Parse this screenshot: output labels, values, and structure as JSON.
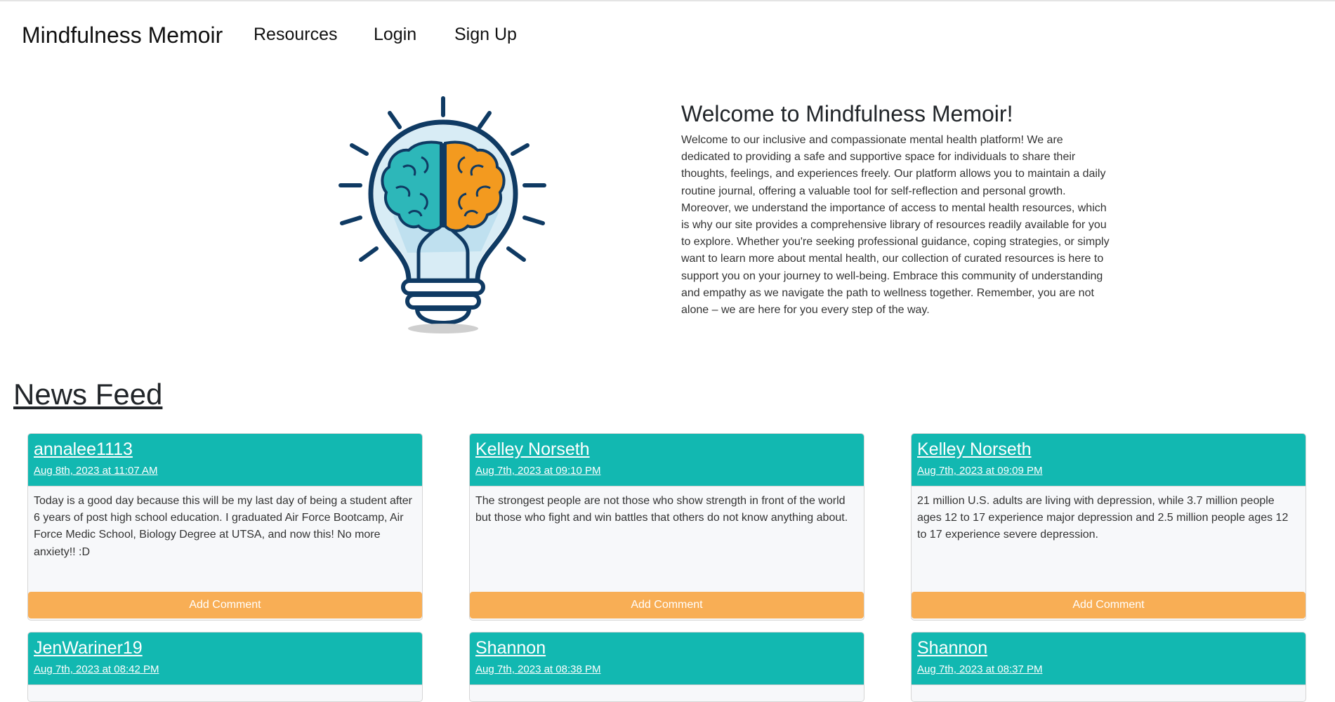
{
  "nav": {
    "brand": "Mindfulness Memoir",
    "links": [
      "Resources",
      "Login",
      "Sign Up"
    ]
  },
  "hero": {
    "title": "Welcome to Mindfulness Memoir!",
    "body": "Welcome to our inclusive and compassionate mental health platform! We are dedicated to providing a safe and supportive space for individuals to share their thoughts, feelings, and experiences freely. Our platform allows you to maintain a daily routine journal, offering a valuable tool for self-reflection and personal growth. Moreover, we understand the importance of access to mental health resources, which is why our site provides a comprehensive library of resources readily available for you to explore. Whether you're seeking professional guidance, coping strategies, or simply want to learn more about mental health, our collection of curated resources is here to support you on your journey to well-being. Embrace this community of understanding and empathy as we navigate the path to wellness together. Remember, you are not alone – we are here for you every step of the way.",
    "image_icon": "lightbulb-brain-icon"
  },
  "feed": {
    "title": "News Feed",
    "button_label": "Add Comment",
    "posts": [
      {
        "user": "annalee1113",
        "date": "Aug 8th, 2023 at 11:07 AM",
        "body": "Today is a good day because this will be my last day of being a student after 6 years of post high school education. I graduated Air Force Bootcamp, Air Force Medic School, Biology Degree at UTSA, and now this! No more anxiety!! :D"
      },
      {
        "user": "Kelley Norseth",
        "date": "Aug 7th, 2023 at 09:10 PM",
        "body": "The strongest people are not those who show strength in front of the world but those who fight and win battles that others do not know anything about."
      },
      {
        "user": "Kelley Norseth",
        "date": "Aug 7th, 2023 at 09:09 PM",
        "body": "21 million U.S. adults are living with depression, while 3.7 million people ages 12 to 17 experience major depression and 2.5 million people ages 12 to 17 experience severe depression."
      },
      {
        "user": "JenWariner19",
        "date": "Aug 7th, 2023 at 08:42 PM",
        "body": ""
      },
      {
        "user": "Shannon",
        "date": "Aug 7th, 2023 at 08:38 PM",
        "body": ""
      },
      {
        "user": "Shannon",
        "date": "Aug 7th, 2023 at 08:37 PM",
        "body": ""
      }
    ]
  },
  "colors": {
    "card_header": "#12b8b1",
    "button": "#f8ae55",
    "card_body": "#f7f8fa",
    "brain_left": "#2db7b9",
    "brain_right": "#f39a1f",
    "outline": "#0f3a63"
  }
}
